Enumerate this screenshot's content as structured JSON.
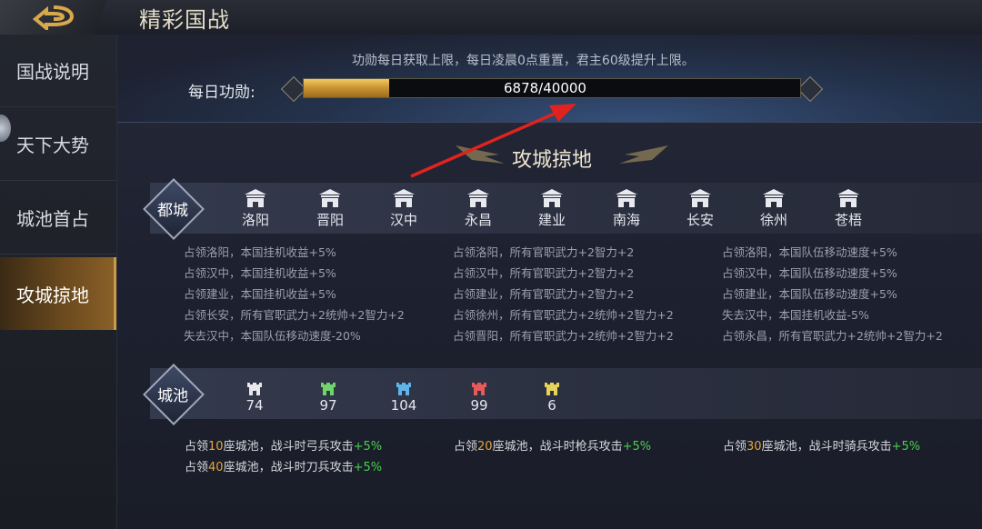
{
  "header": {
    "title": "精彩国战",
    "back_icon": "back-arrow-icon"
  },
  "sidebar": {
    "items": [
      {
        "label": "国战说明"
      },
      {
        "label": "天下大势"
      },
      {
        "label": "城池首占"
      },
      {
        "label": "攻城掠地"
      }
    ],
    "active_index": 3
  },
  "merit": {
    "notice": "功勋每日获取上限，每日凌晨0点重置，君主60级提升上限。",
    "label": "每日功勋:",
    "current": 6878,
    "max": 40000,
    "text": "6878/40000"
  },
  "section": {
    "title": "攻城掠地"
  },
  "capitals": {
    "badge": "都城",
    "names": [
      "洛阳",
      "晋阳",
      "汉中",
      "永昌",
      "建业",
      "南海",
      "长安",
      "徐州",
      "苍梧"
    ],
    "effects": [
      [
        "占领洛阳，本国挂机收益+5%",
        "占领汉中，本国挂机收益+5%",
        "占领建业，本国挂机收益+5%",
        "占领长安，所有官职武力+2统帅+2智力+2",
        "失去汉中，本国队伍移动速度-20%"
      ],
      [
        "占领洛阳，所有官职武力+2智力+2",
        "占领汉中，所有官职武力+2智力+2",
        "占领建业，所有官职武力+2智力+2",
        "占领徐州，所有官职武力+2统帅+2智力+2",
        "占领晋阳，所有官职武力+2统帅+2智力+2"
      ],
      [
        "占领洛阳，本国队伍移动速度+5%",
        "占领汉中，本国队伍移动速度+5%",
        "占领建业，本国队伍移动速度+5%",
        "失去汉中，本国挂机收益-5%",
        "占领永昌，所有官职武力+2统帅+2智力+2"
      ]
    ]
  },
  "cities": {
    "badge": "城池",
    "items": [
      {
        "count": "74",
        "color": "#e8e8ea"
      },
      {
        "count": "97",
        "color": "#6fd46a"
      },
      {
        "count": "104",
        "color": "#5fb4ea"
      },
      {
        "count": "99",
        "color": "#e85a5a"
      },
      {
        "count": "6",
        "color": "#e8d35a"
      }
    ],
    "bonuses": [
      {
        "pre": "占领",
        "num": "10",
        "post": "座城池，战斗时弓兵攻击",
        "plus": "+5%"
      },
      {
        "pre": "占领",
        "num": "20",
        "post": "座城池，战斗时枪兵攻击",
        "plus": "+5%"
      },
      {
        "pre": "占领",
        "num": "30",
        "post": "座城池，战斗时骑兵攻击",
        "plus": "+5%"
      },
      {
        "pre": "占领",
        "num": "40",
        "post": "座城池，战斗时刀兵攻击",
        "plus": "+5%"
      }
    ]
  },
  "colors": {
    "accent_gold": "#c8922f",
    "plus_green": "#47d14a",
    "arrow_red": "#e0231e"
  }
}
